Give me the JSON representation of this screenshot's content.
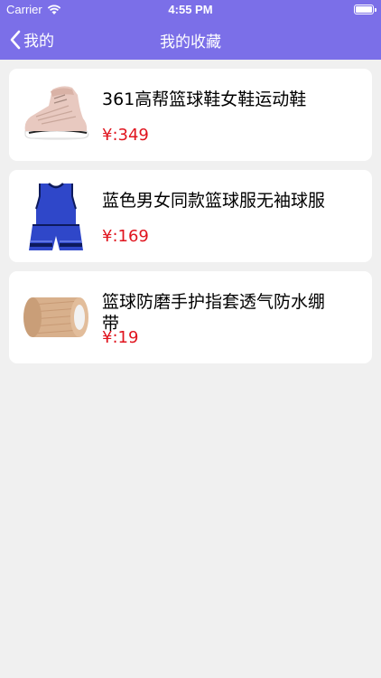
{
  "status_bar": {
    "carrier": "Carrier",
    "time": "4:55 PM"
  },
  "nav": {
    "back_label": "我的",
    "title": "我的收藏"
  },
  "colors": {
    "header": "#7b6fe8",
    "price": "#e0141e"
  },
  "favorites": [
    {
      "title": "361高帮篮球鞋女鞋运动鞋",
      "price": "¥:349",
      "thumb": "shoe-icon"
    },
    {
      "title": "蓝色男女同款篮球服无袖球服",
      "price": "¥:169",
      "thumb": "jersey-icon"
    },
    {
      "title": "篮球防磨手护指套透气防水绷带",
      "price": "¥:19",
      "thumb": "bandage-roll-icon"
    }
  ]
}
